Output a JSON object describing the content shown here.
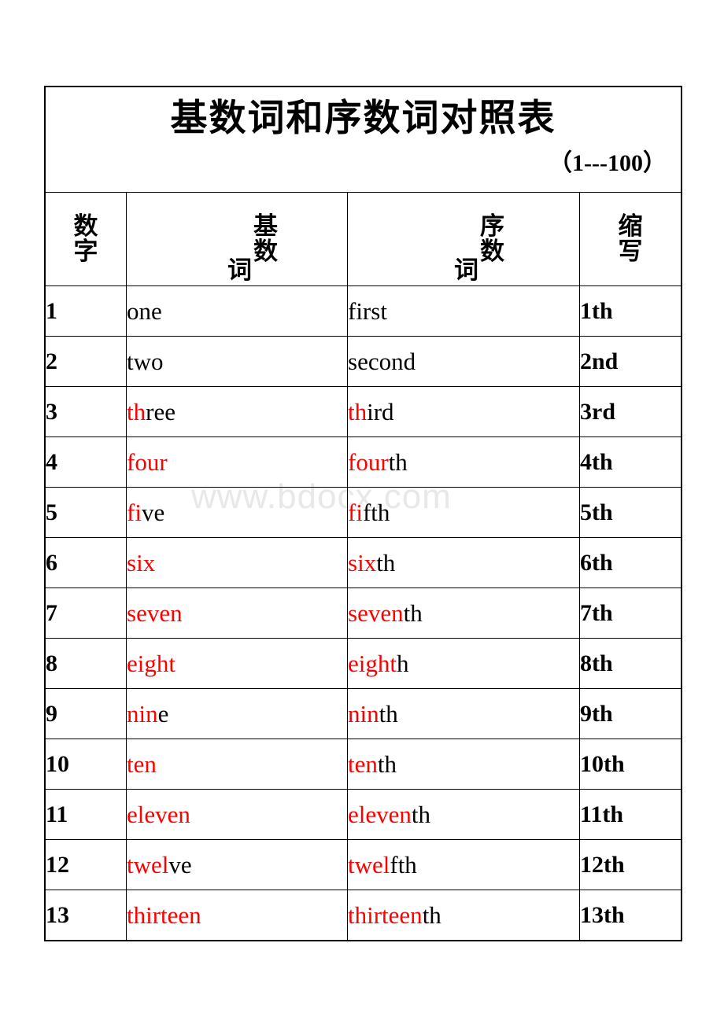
{
  "document": {
    "title": "基数词和序数词对照表",
    "range": "（1---100）",
    "watermark": "www.bdocx.com",
    "highlight_color": "#ff0000",
    "text_color": "#000000"
  },
  "table": {
    "headers": {
      "number": {
        "chars": [
          "数",
          "字"
        ]
      },
      "cardinal": {
        "side_char": "词",
        "stacked_chars": [
          "基",
          "数"
        ],
        "full": "基数词"
      },
      "ordinal": {
        "side_char": "词",
        "stacked_chars": [
          "序",
          "数"
        ],
        "full": "序数词"
      },
      "abbreviation": {
        "chars": [
          "缩",
          "写"
        ]
      }
    },
    "rows": [
      {
        "number": "1",
        "cardinal": [
          {
            "text": "one",
            "red": false
          }
        ],
        "ordinal": [
          {
            "text": "first",
            "red": false
          }
        ],
        "abbr": "1th"
      },
      {
        "number": "2",
        "cardinal": [
          {
            "text": "two",
            "red": false
          }
        ],
        "ordinal": [
          {
            "text": "second",
            "red": false
          }
        ],
        "abbr": "2nd"
      },
      {
        "number": "3",
        "cardinal": [
          {
            "text": "th",
            "red": true
          },
          {
            "text": "ree",
            "red": false
          }
        ],
        "ordinal": [
          {
            "text": "th",
            "red": true
          },
          {
            "text": "ird",
            "red": false
          }
        ],
        "abbr": "3rd"
      },
      {
        "number": "4",
        "cardinal": [
          {
            "text": "four",
            "red": true
          }
        ],
        "ordinal": [
          {
            "text": "four",
            "red": true
          },
          {
            "text": "th",
            "red": false
          }
        ],
        "abbr": "4th"
      },
      {
        "number": "5",
        "cardinal": [
          {
            "text": "fi",
            "red": true
          },
          {
            "text": "ve",
            "red": false
          }
        ],
        "ordinal": [
          {
            "text": "fi",
            "red": true
          },
          {
            "text": "fth",
            "red": false
          }
        ],
        "abbr": "5th"
      },
      {
        "number": "6",
        "cardinal": [
          {
            "text": "six",
            "red": true
          }
        ],
        "ordinal": [
          {
            "text": "six",
            "red": true
          },
          {
            "text": "th",
            "red": false
          }
        ],
        "abbr": "6th"
      },
      {
        "number": "7",
        "cardinal": [
          {
            "text": "seven",
            "red": true
          }
        ],
        "ordinal": [
          {
            "text": "seven",
            "red": true
          },
          {
            "text": "th",
            "red": false
          }
        ],
        "abbr": "7th"
      },
      {
        "number": "8",
        "cardinal": [
          {
            "text": "eight",
            "red": true
          }
        ],
        "ordinal": [
          {
            "text": "eight",
            "red": true
          },
          {
            "text": "h",
            "red": false
          }
        ],
        "abbr": "8th"
      },
      {
        "number": "9",
        "cardinal": [
          {
            "text": "nin",
            "red": true
          },
          {
            "text": "e",
            "red": false
          }
        ],
        "ordinal": [
          {
            "text": "nin",
            "red": true
          },
          {
            "text": "th",
            "red": false
          }
        ],
        "abbr": "9th"
      },
      {
        "number": "10",
        "cardinal": [
          {
            "text": "ten",
            "red": true
          }
        ],
        "ordinal": [
          {
            "text": "ten",
            "red": true
          },
          {
            "text": "th",
            "red": false
          }
        ],
        "abbr": "10th"
      },
      {
        "number": "11",
        "cardinal": [
          {
            "text": "eleven",
            "red": true
          }
        ],
        "ordinal": [
          {
            "text": "eleven",
            "red": true
          },
          {
            "text": "th",
            "red": false
          }
        ],
        "abbr": "11th"
      },
      {
        "number": "12",
        "cardinal": [
          {
            "text": "twel",
            "red": true
          },
          {
            "text": "ve",
            "red": false
          }
        ],
        "ordinal": [
          {
            "text": "twel",
            "red": true
          },
          {
            "text": "fth",
            "red": false
          }
        ],
        "abbr": "12th"
      },
      {
        "number": "13",
        "cardinal": [
          {
            "text": "thirteen",
            "red": true
          }
        ],
        "ordinal": [
          {
            "text": "thirteen",
            "red": true
          },
          {
            "text": "th",
            "red": false
          }
        ],
        "abbr": "13th"
      }
    ]
  }
}
